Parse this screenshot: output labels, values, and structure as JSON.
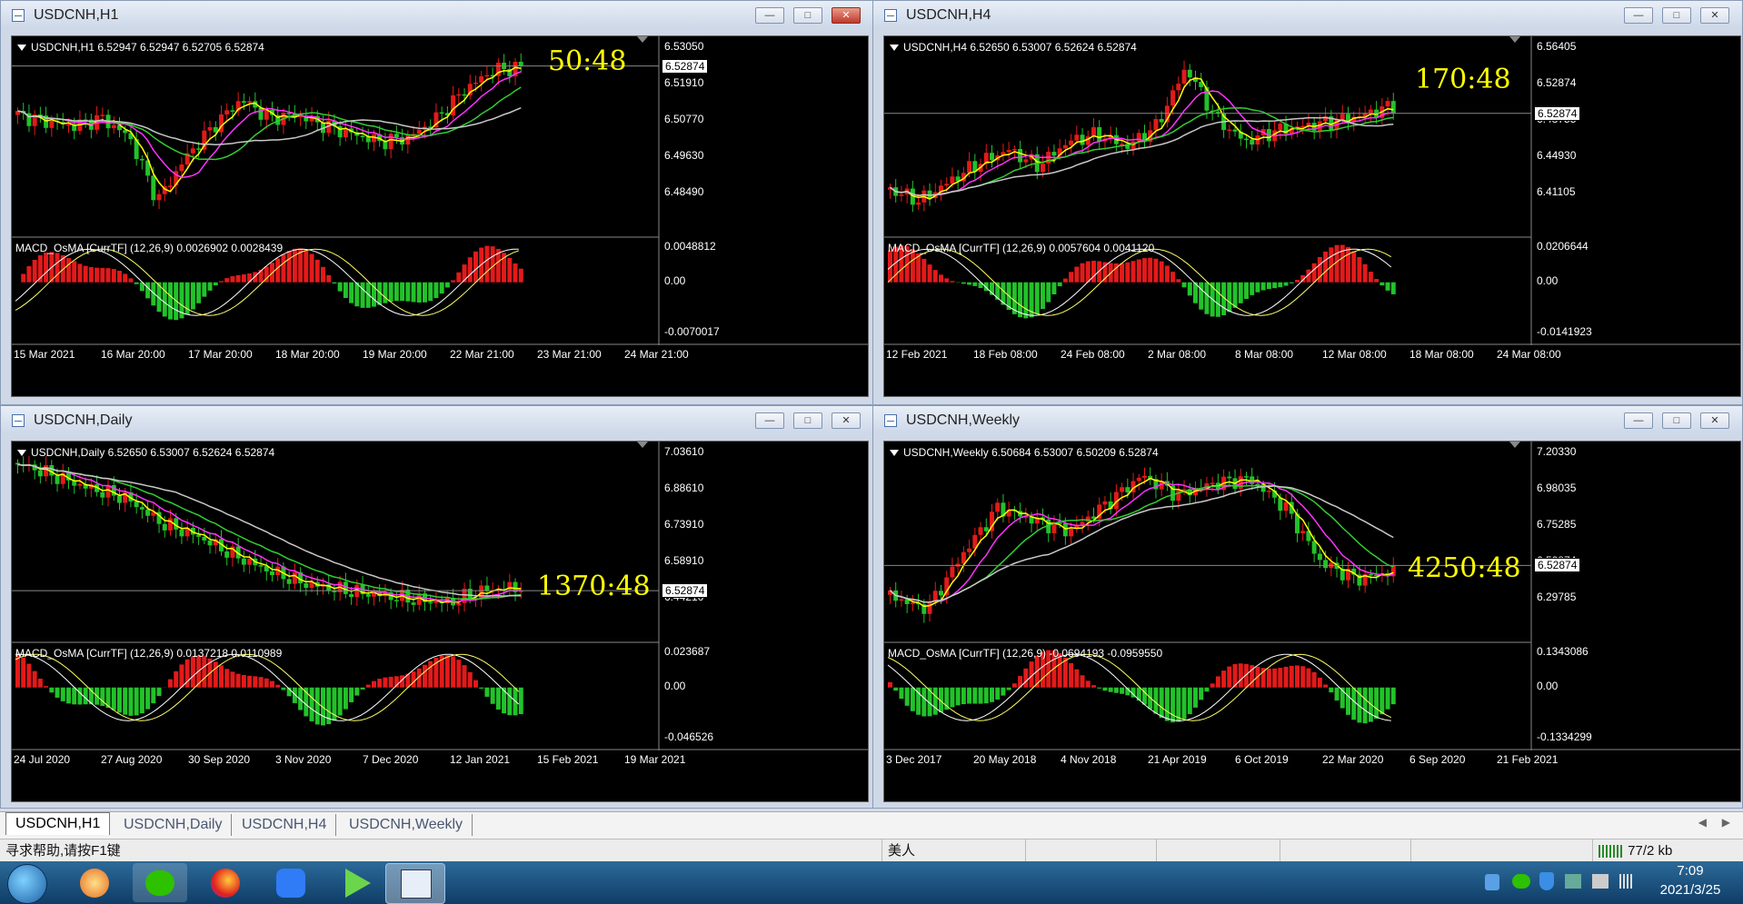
{
  "windows": [
    {
      "title": "USDCNH,H1",
      "symbol_line": "USDCNH,H1  6.52947 6.52947 6.52705 6.52874",
      "timer": "50:48",
      "price_levels": [
        "6.53050",
        "6.51910",
        "6.50770",
        "6.49630",
        "6.48490"
      ],
      "current_price": "6.52874",
      "indicator_line": "MACD_OsMA [CurrTF] (12,26,9) 0.0026902 0.0028439",
      "indicator_levels": [
        "0.0048812",
        "0.00",
        "-0.0070017"
      ],
      "time_labels": [
        "15 Mar 2021",
        "16 Mar 20:00",
        "17 Mar 20:00",
        "18 Mar 20:00",
        "19 Mar 20:00",
        "22 Mar 21:00",
        "23 Mar 21:00",
        "24 Mar 21:00"
      ]
    },
    {
      "title": "USDCNH,H4",
      "symbol_line": "USDCNH,H4  6.52650 6.53007 6.52624 6.52874",
      "timer": "170:48",
      "price_levels": [
        "6.56405",
        "6.52874",
        "6.48755",
        "6.44930",
        "6.41105"
      ],
      "current_price": "6.52874",
      "indicator_line": "MACD_OsMA [CurrTF] (12,26,9) 0.0057604 0.0041120",
      "indicator_levels": [
        "0.0206644",
        "0.00",
        "-0.0141923"
      ],
      "time_labels": [
        "12 Feb 2021",
        "18 Feb 08:00",
        "24 Feb 08:00",
        "2 Mar 08:00",
        "8 Mar 08:00",
        "12 Mar 08:00",
        "18 Mar 08:00",
        "24 Mar 08:00"
      ]
    },
    {
      "title": "USDCNH,Daily",
      "symbol_line": "USDCNH,Daily  6.52650 6.53007 6.52624 6.52874",
      "timer": "1370:48",
      "price_levels": [
        "7.03610",
        "6.88610",
        "6.73910",
        "6.58910",
        "6.44210"
      ],
      "current_price": "6.52874",
      "indicator_line": "MACD_OsMA [CurrTF] (12,26,9) 0.0137218 0.0110989",
      "indicator_levels": [
        "0.023687",
        "0.00",
        "-0.046526"
      ],
      "time_labels": [
        "24 Jul 2020",
        "27 Aug 2020",
        "30 Sep 2020",
        "3 Nov 2020",
        "7 Dec 2020",
        "12 Jan 2021",
        "15 Feb 2021",
        "19 Mar 2021"
      ]
    },
    {
      "title": "USDCNH,Weekly",
      "symbol_line": "USDCNH,Weekly  6.50684 6.53007 6.50209 6.52874",
      "timer": "4250:48",
      "price_levels": [
        "7.20330",
        "6.98035",
        "6.75285",
        "6.52874",
        "6.29785"
      ],
      "current_price": "6.52874",
      "indicator_line": "MACD_OsMA [CurrTF] (12,26,9) -0.0694193 -0.0959550",
      "indicator_levels": [
        "0.1343086",
        "0.00",
        "-0.1334299"
      ],
      "time_labels": [
        "3 Dec 2017",
        "20 May 2018",
        "4 Nov 2018",
        "21 Apr 2019",
        "6 Oct 2019",
        "22 Mar 2020",
        "6 Sep 2020",
        "21 Feb 2021"
      ]
    }
  ],
  "tabs": [
    "USDCNH,H1",
    "USDCNH,Daily",
    "USDCNH,H4",
    "USDCNH,Weekly"
  ],
  "status": {
    "help": "寻求帮助,请按F1键",
    "profile": "美人",
    "traffic": "77/2 kb"
  },
  "taskbar": {
    "time": "7:09",
    "date": "2021/3/25"
  },
  "colors": {
    "bull": "#e31a1a",
    "bear": "#22c22a",
    "timer": "#ffff00",
    "ma_fast": "#ffff00",
    "ma_mid": "#ff33ff",
    "ma_slow": "#33cc33",
    "ma_long": "#c8c8c8"
  }
}
